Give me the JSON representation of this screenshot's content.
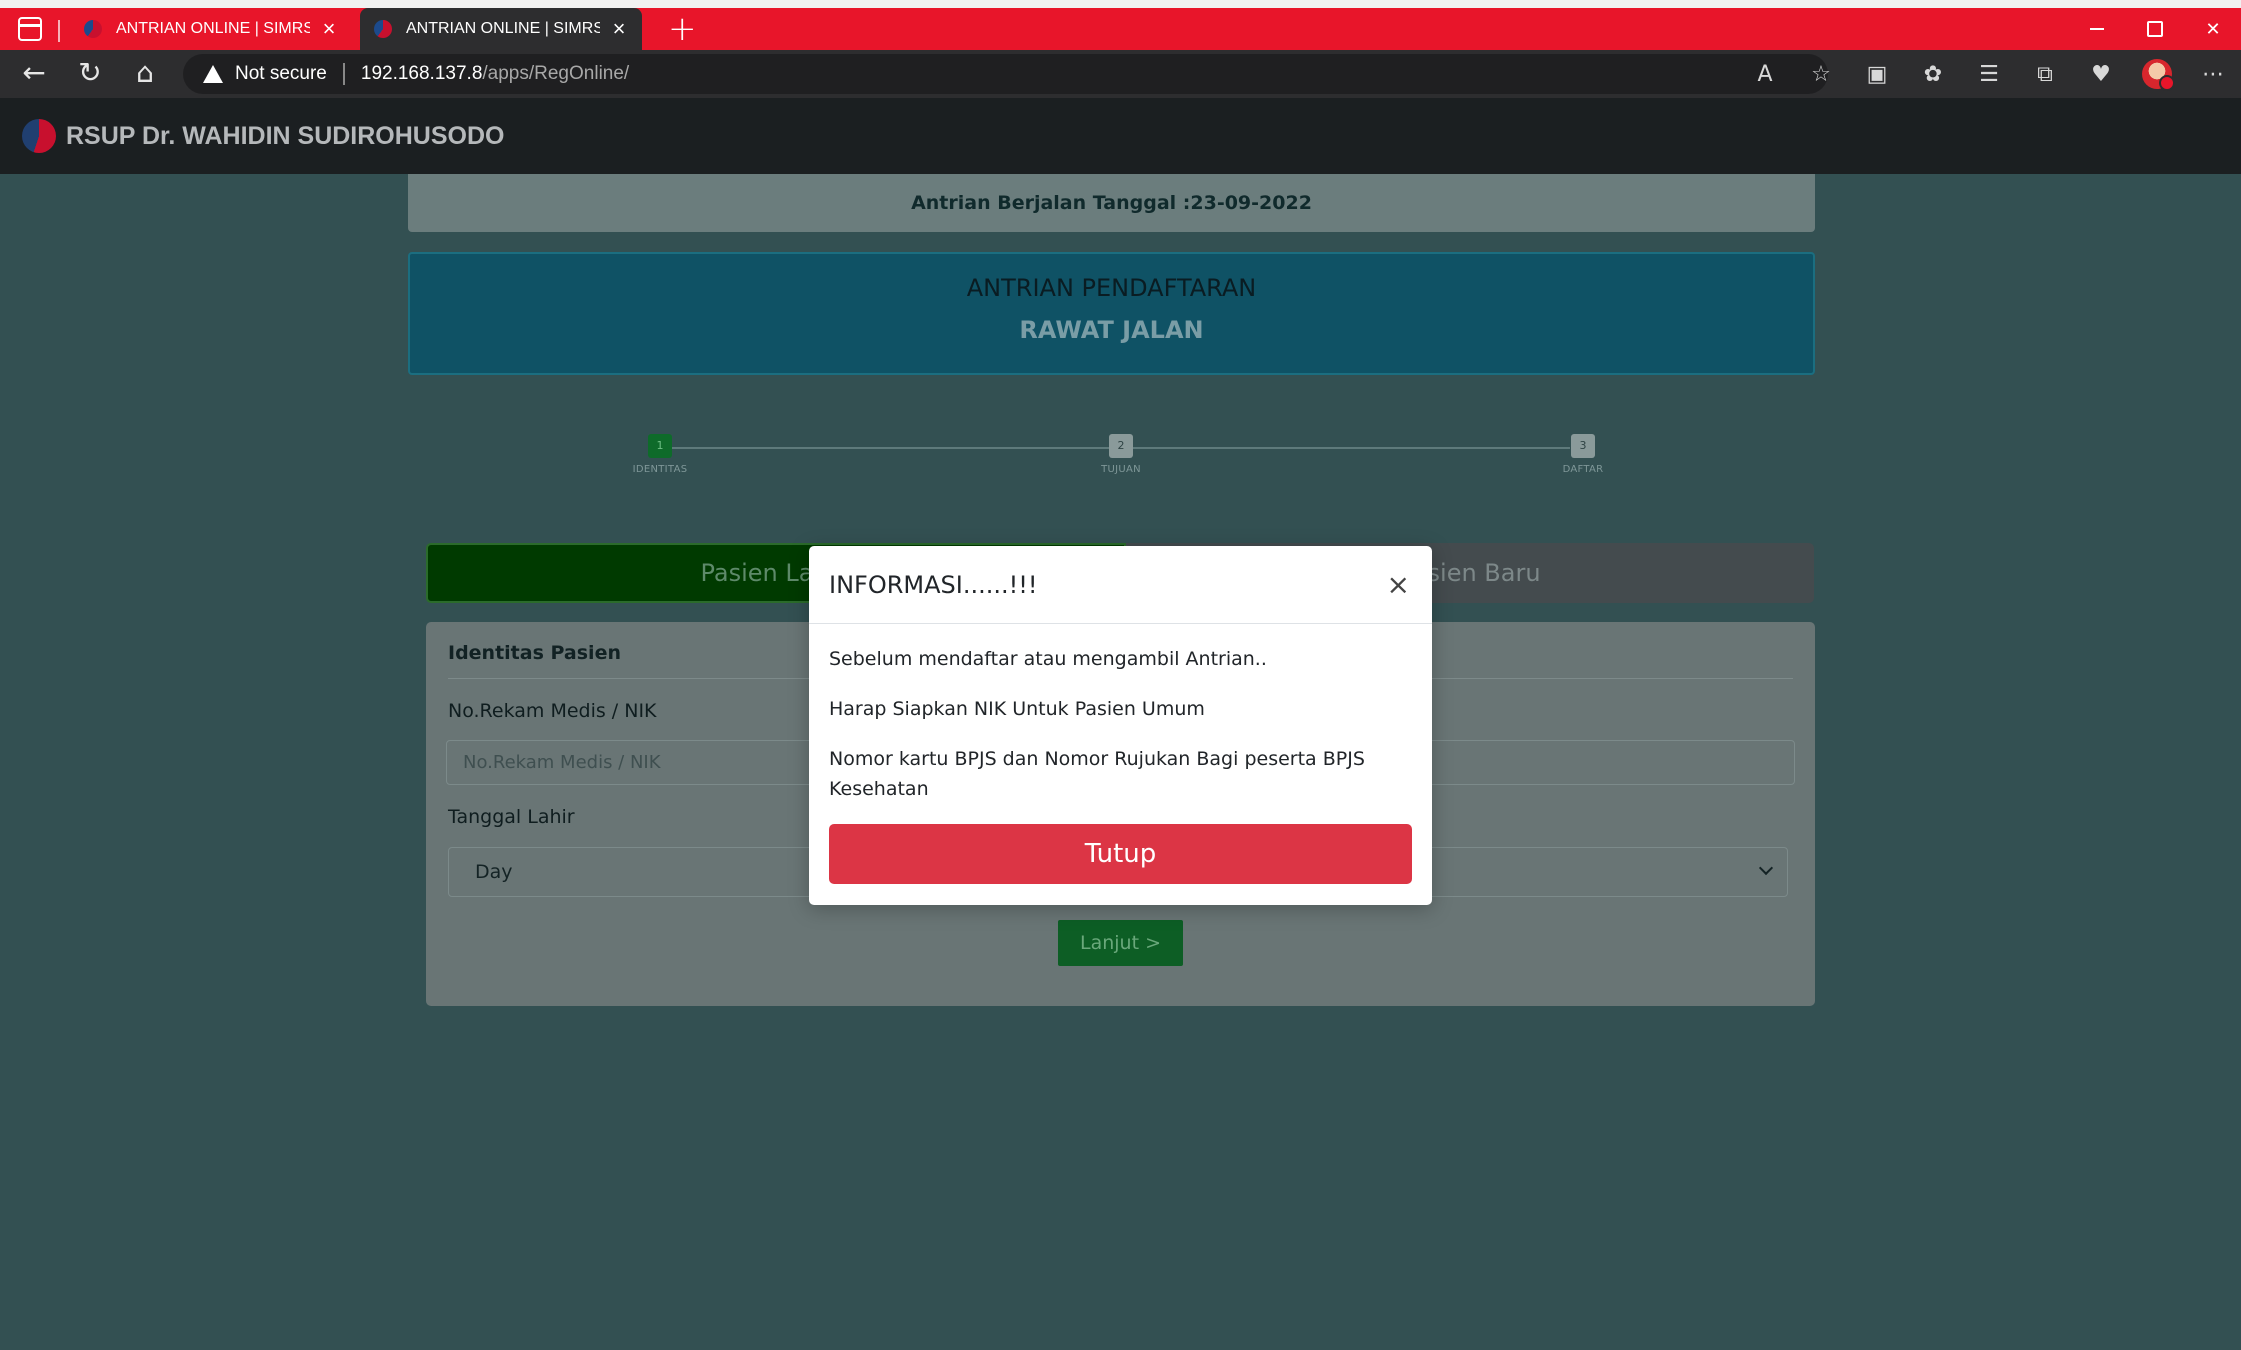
{
  "browser": {
    "tabs": [
      {
        "title": "ANTRIAN ONLINE | SIMRSGOS V"
      },
      {
        "title": "ANTRIAN ONLINE | SIMRSGOS V"
      }
    ],
    "security_label": "Not secure",
    "url_host": "192.168.137.8",
    "url_path": "/apps/RegOnline/"
  },
  "header": {
    "brand": "RSUP Dr. WAHIDIN SUDIROHUSODO"
  },
  "queue": {
    "date_text": "Antrian Berjalan Tanggal :23-09-2022",
    "title_line1": "ANTRIAN PENDAFTARAN",
    "title_line2": "RAWAT JALAN"
  },
  "stepper": {
    "steps": [
      {
        "num": "1",
        "label": "IDENTITAS",
        "active": true
      },
      {
        "num": "2",
        "label": "TUJUAN",
        "active": false
      },
      {
        "num": "3",
        "label": "DAFTAR",
        "active": false
      }
    ]
  },
  "patient_tabs": {
    "lama": "Pasien Lama",
    "baru": "Pasien Baru"
  },
  "form": {
    "heading": "Identitas Pasien",
    "rm_label": "No.Rekam Medis / NIK",
    "rm_placeholder": "No.Rekam Medis / NIK",
    "dob_label": "Tanggal Lahir",
    "day_value": "Day",
    "next_label": "Lanjut >"
  },
  "modal": {
    "title": "INFORMASI......!!!",
    "close_symbol": "×",
    "lines": [
      "Sebelum mendaftar atau mengambil Antrian..",
      "Harap Siapkan NIK Untuk Pasien Umum",
      "Nomor kartu BPJS dan Nomor Rujukan Bagi peserta BPJS Kesehatan"
    ],
    "button_label": "Tutup"
  },
  "colors": {
    "browser_accent": "#e8152a",
    "page_overlay": "#335052",
    "danger": "#dc3545"
  }
}
